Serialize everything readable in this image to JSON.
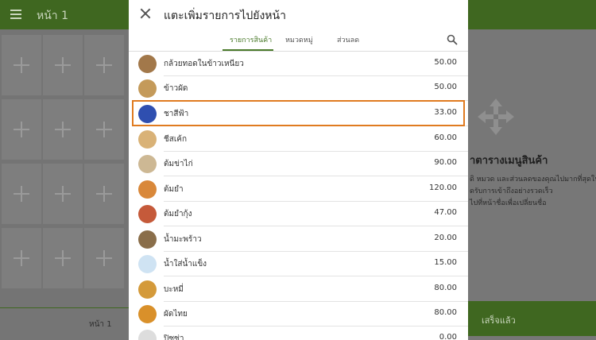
{
  "background": {
    "page_title": "หน้า 1",
    "bottom_tab": "หน้า 1",
    "heading": "าตารางเมนูสินค้า",
    "lines": [
      "ดิ หมวด และส่วนลดของคุณไปมากที่สุดใน",
      "ดรับการเข้าถึงอย่างรวดเร็ว",
      "ไปที่หน้าชื่อเพื่อเปลี่ยนชื่อ"
    ],
    "done_label": "เสร็จแล้ว"
  },
  "dialog": {
    "title": "แตะเพิ่มรายการไปยังหน้า",
    "tabs": [
      {
        "label": "รายการสินค้า",
        "active": true
      },
      {
        "label": "หมวดหมู่",
        "active": false
      },
      {
        "label": "ส่วนลด",
        "active": false
      }
    ],
    "items": [
      {
        "name": "กล้วยทอดในข้าวเหนียว",
        "price": "50.00",
        "color": "#a2784a"
      },
      {
        "name": "ข้าวผัด",
        "price": "50.00",
        "color": "#c49a5a"
      },
      {
        "name": "ชาสีฟ้า",
        "price": "33.00",
        "color": "#2f4fb0"
      },
      {
        "name": "ชีสเค้ก",
        "price": "60.00",
        "color": "#d9b277"
      },
      {
        "name": "ต้มข่าไก่",
        "price": "90.00",
        "color": "#cdb894"
      },
      {
        "name": "ต้มยำ",
        "price": "120.00",
        "color": "#d9883a"
      },
      {
        "name": "ต้มยำกุ้ง",
        "price": "47.00",
        "color": "#c55a3a"
      },
      {
        "name": "น้ำมะพร้าว",
        "price": "20.00",
        "color": "#8a6e4a"
      },
      {
        "name": "น้ำใส่น้ำแข็ง",
        "price": "15.00",
        "color": "#cfe3f3"
      },
      {
        "name": "บะหมี่",
        "price": "80.00",
        "color": "#d49a3a"
      },
      {
        "name": "ผัดไทย",
        "price": "80.00",
        "color": "#d9902a"
      },
      {
        "name": "ปิซซ่า",
        "price": "0.00",
        "color": "#dddddd"
      }
    ]
  }
}
